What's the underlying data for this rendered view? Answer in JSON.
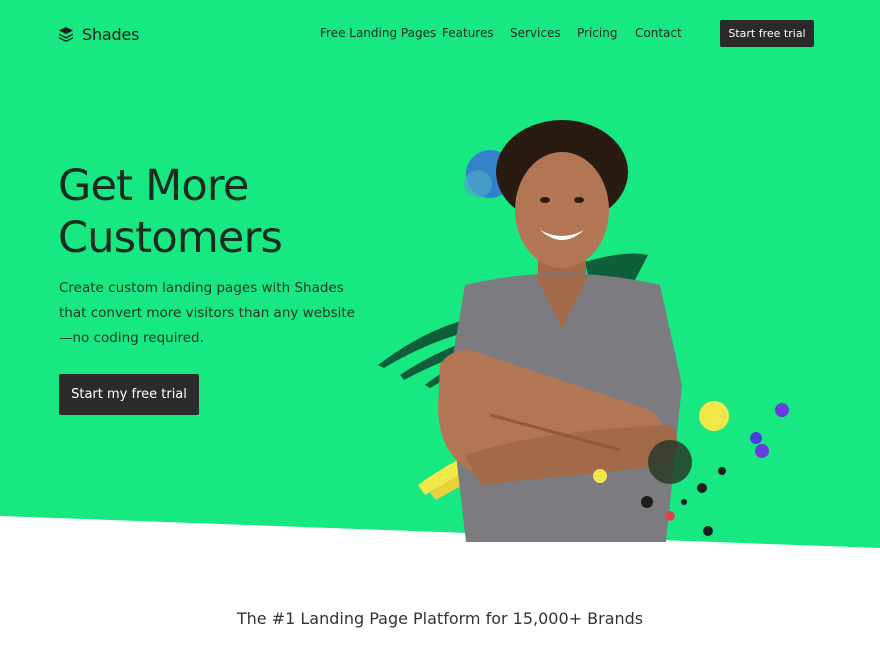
{
  "brand": {
    "name": "Shades",
    "icon": "layers-icon"
  },
  "nav": {
    "links": [
      "Free Landing Pages",
      "Features",
      "Services",
      "Pricing",
      "Contact"
    ],
    "cta_label": "Start free trial"
  },
  "hero": {
    "title_line1": "Get More",
    "title_line2": "Customers",
    "subtitle": "Create custom landing pages with Shades that convert more visitors than any website—no coding required.",
    "cta_label": "Start my free trial",
    "image": "smiling-man-crossed-arms-photo"
  },
  "section": {
    "tagline": "The #1 Landing Page Platform for 15,000+ Brands"
  },
  "colors": {
    "hero_bg": "#17e881",
    "button_bg": "#2b2b2b",
    "text_dark": "#1a2a20",
    "accent_blue": "#3a6fd8",
    "accent_yellow": "#f2e84a",
    "accent_purple": "#6a3de0",
    "accent_dark_green": "#0f5e3a"
  }
}
